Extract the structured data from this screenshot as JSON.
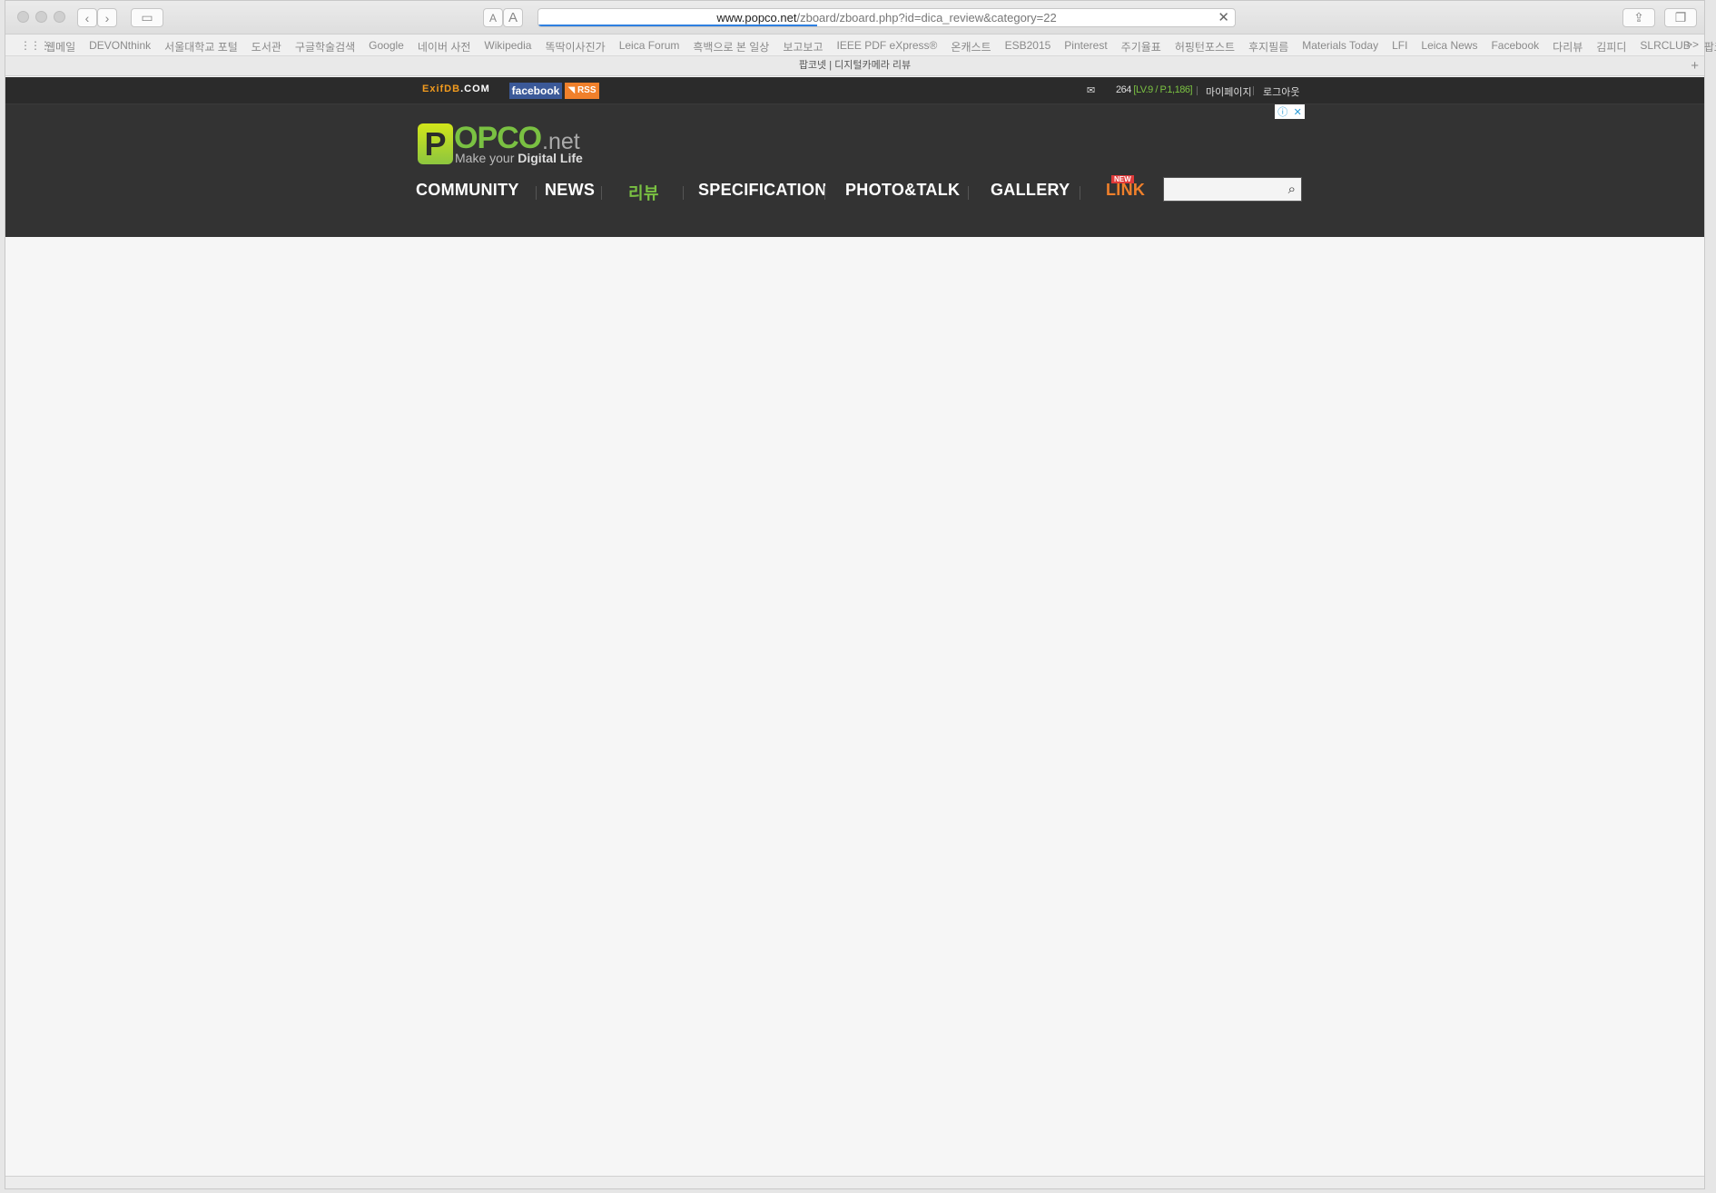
{
  "browser": {
    "url_host": "www.popco.net",
    "url_path": "/zboard/zboard.php?id=dica_review&category=22",
    "reader_small": "A",
    "reader_large": "A",
    "load_progress_percent": 40
  },
  "bookmarks": {
    "grid_icon": "⋮⋮⋮",
    "items": [
      "웹메일",
      "DEVONthink",
      "서울대학교 포털",
      "도서관",
      "구글학술검색",
      "Google",
      "네이버 사전",
      "Wikipedia",
      "똑딱이사진가",
      "Leica Forum",
      "흑백으로 본 일상",
      "보고보고",
      "IEEE PDF eXpress®",
      "온캐스트",
      "ESB2015",
      "Pinterest",
      "주기율표",
      "허핑턴포스트",
      "후지필름",
      "Materials Today",
      "LFI",
      "Leica News",
      "Facebook",
      "다리뷰",
      "김피디",
      "SLRCLUB",
      "팝코넷"
    ],
    "more": ">>"
  },
  "tab": {
    "title": "팝코넷 | 디지털카메라 리뷰",
    "add": "+"
  },
  "site": {
    "exif_brand": "ExifDB",
    "exif_suffix": ".COM",
    "facebook_label": "facebook",
    "rss_label": "RSS",
    "mail_icon": "✉",
    "points": "264",
    "level": "[LV.9 / P.1,186]",
    "mypage": "마이페이지",
    "logout": "로그아웃",
    "ad_info": "ⓘ",
    "ad_close": "✕",
    "logo_p": "P",
    "logo_opco": "OPCO",
    "logo_net": ".net",
    "logo_tag_a": "Make your ",
    "logo_tag_b": "Digital Life",
    "nav": {
      "community": "COMMUNITY",
      "news": "NEWS",
      "review": "리뷰",
      "specification": "SPECIFICATION",
      "photo_talk": "PHOTO&TALK",
      "gallery": "GALLERY",
      "link": "LINK",
      "new_badge": "NEW"
    },
    "search_placeholder": ""
  },
  "colors": {
    "accent_green": "#7ac142",
    "link_orange": "#f0802b",
    "facebook_blue": "#3b5998"
  }
}
